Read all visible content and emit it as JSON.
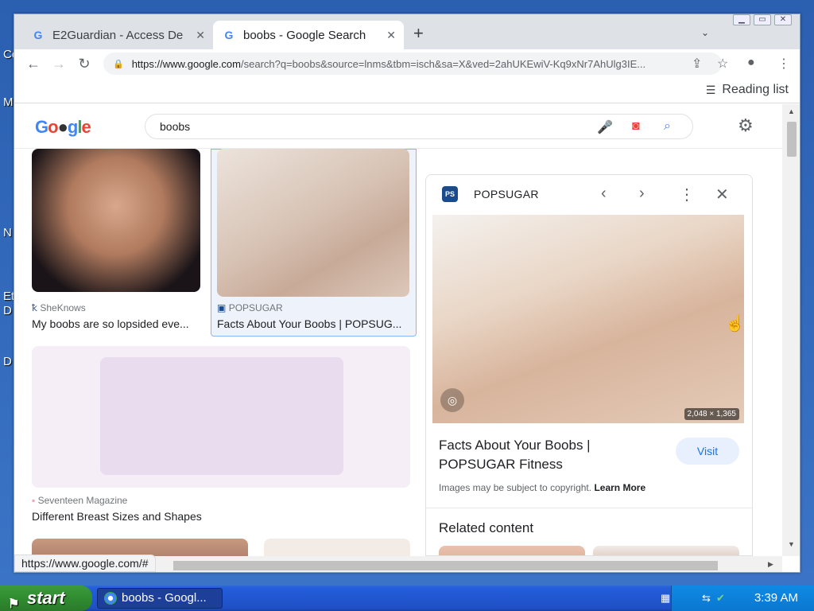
{
  "desktop": {
    "letters": [
      "Co",
      "M",
      "N",
      "Et",
      "D",
      "D"
    ]
  },
  "browser": {
    "tabs": [
      {
        "title": "E2Guardian - Access De",
        "favicon": "google-g-icon",
        "active": false
      },
      {
        "title": "boobs - Google Search",
        "favicon": "google-g-icon",
        "active": true
      }
    ],
    "new_tab": "+",
    "url_host": "https://www.google.com",
    "url_path": "/search?q=boobs&source=lnms&tbm=isch&sa=X&ved=2ahUKEwiV-Kq9xNr7AhUlg3IE...",
    "reading_list": "Reading list",
    "status_url": "https://www.google.com/#"
  },
  "google": {
    "logo": "Google",
    "query": "boobs"
  },
  "results": [
    {
      "source": "SheKnows",
      "title": "My boobs are so lopsided eve..."
    },
    {
      "source": "POPSUGAR",
      "title": "Facts About Your Boobs | POPSUG..."
    },
    {
      "source": "Seventeen Magazine",
      "title": "Different Breast Sizes and Shapes"
    }
  ],
  "panel": {
    "logo_text": "PS",
    "source": "POPSUGAR",
    "dimensions": "2,048 × 1,365",
    "title": "Facts About Your Boobs | POPSUGAR Fitness",
    "visit": "Visit",
    "copyright": "Images may be subject to copyright.",
    "learn_more": "Learn More",
    "related": "Related content"
  },
  "taskbar": {
    "start": "start",
    "item": "boobs - Googl...",
    "clock": "3:39 AM"
  },
  "colors": {
    "accent": "#1a73e8",
    "taskbar": "#245edb",
    "start": "#308c30"
  }
}
